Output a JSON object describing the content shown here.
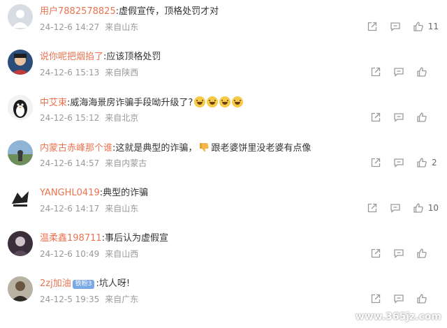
{
  "comments": [
    {
      "user": "用户7882578825",
      "text": ":虚假宣传，顶格处罚才对",
      "time": "24-12-6 14:27",
      "source": "来自山东",
      "likes": "11"
    },
    {
      "user": "说你呢把烟掐了",
      "text": ":应该顶格处罚",
      "time": "24-12-6 15:13",
      "source": "来自陕西",
      "likes": ""
    },
    {
      "user": "中艾束",
      "text": ":威海海景房诈骗手段呦升级了?",
      "emoji": [
        "laugh-cry-emoji",
        "laugh-cry-emoji",
        "laugh-cry-emoji",
        "laugh-cry-emoji"
      ],
      "time": "24-12-6 15:12",
      "source": "来自北京",
      "likes": ""
    },
    {
      "user": "内蒙古赤峰那个谁",
      "text": ":这就是典型的诈骗，",
      "text2": "跟老婆饼里没老婆有点像",
      "time": "24-12-6 14:57",
      "source": "来自内蒙古",
      "likes": "2"
    },
    {
      "user": "YANGHL0419",
      "text": ":典型的诈骗",
      "time": "24-12-6 14:17",
      "source": "来自山东",
      "likes": "10"
    },
    {
      "user": "温柔鑫198711",
      "text": ":事后认为虚假宣",
      "time": "24-12-6 10:49",
      "source": "来自山西",
      "likes": ""
    },
    {
      "user": "2zj加油",
      "badge": "铁粉3",
      "text": ":坑人呀!",
      "time": "24-12-5 19:35",
      "source": "来自广东",
      "likes": ""
    }
  ],
  "icons": {
    "share": "share-icon",
    "reply": "comment-icon",
    "like": "thumbs-up-icon"
  },
  "watermark": "www.365jz.com",
  "colors": {
    "username": "#eb7350",
    "meta": "#999999",
    "icon": "#9a9a9a"
  }
}
